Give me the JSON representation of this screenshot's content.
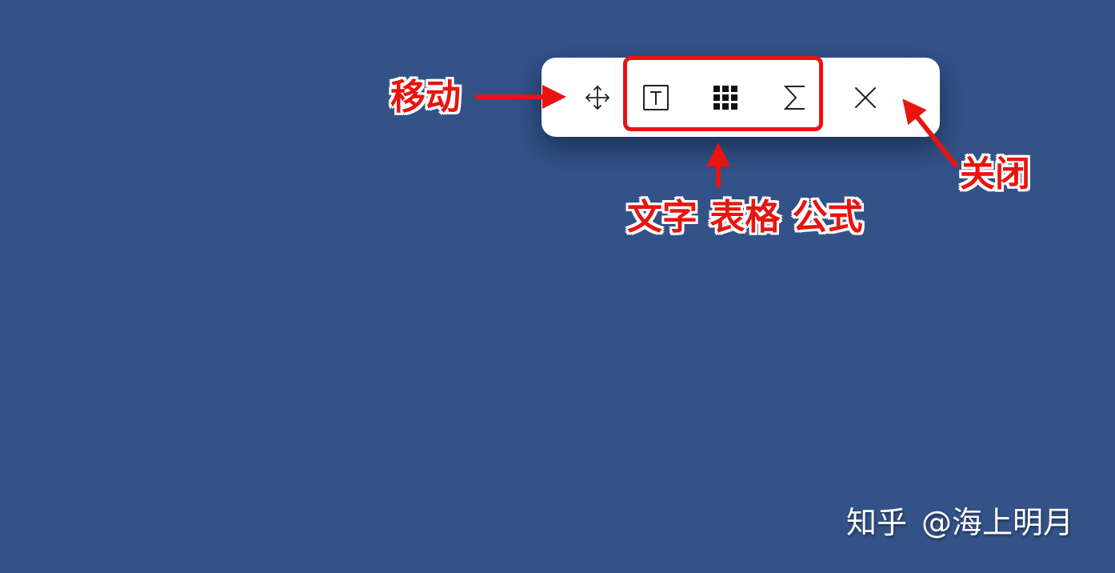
{
  "toolbar": {
    "buttons": [
      {
        "id": "move",
        "icon": "move-arrows-icon"
      },
      {
        "id": "text",
        "icon": "text-box-icon"
      },
      {
        "id": "table",
        "icon": "table-grid-icon"
      },
      {
        "id": "formula",
        "icon": "sigma-icon"
      },
      {
        "id": "close",
        "icon": "close-icon"
      }
    ]
  },
  "annotations": {
    "move": "移动",
    "tools": "文字 表格 公式",
    "close": "关闭"
  },
  "watermark": {
    "brand": "知乎",
    "author": "@海上明月"
  },
  "colors": {
    "background": "#335287",
    "annotation": "#e8140f",
    "toolbar": "#ffffff"
  }
}
